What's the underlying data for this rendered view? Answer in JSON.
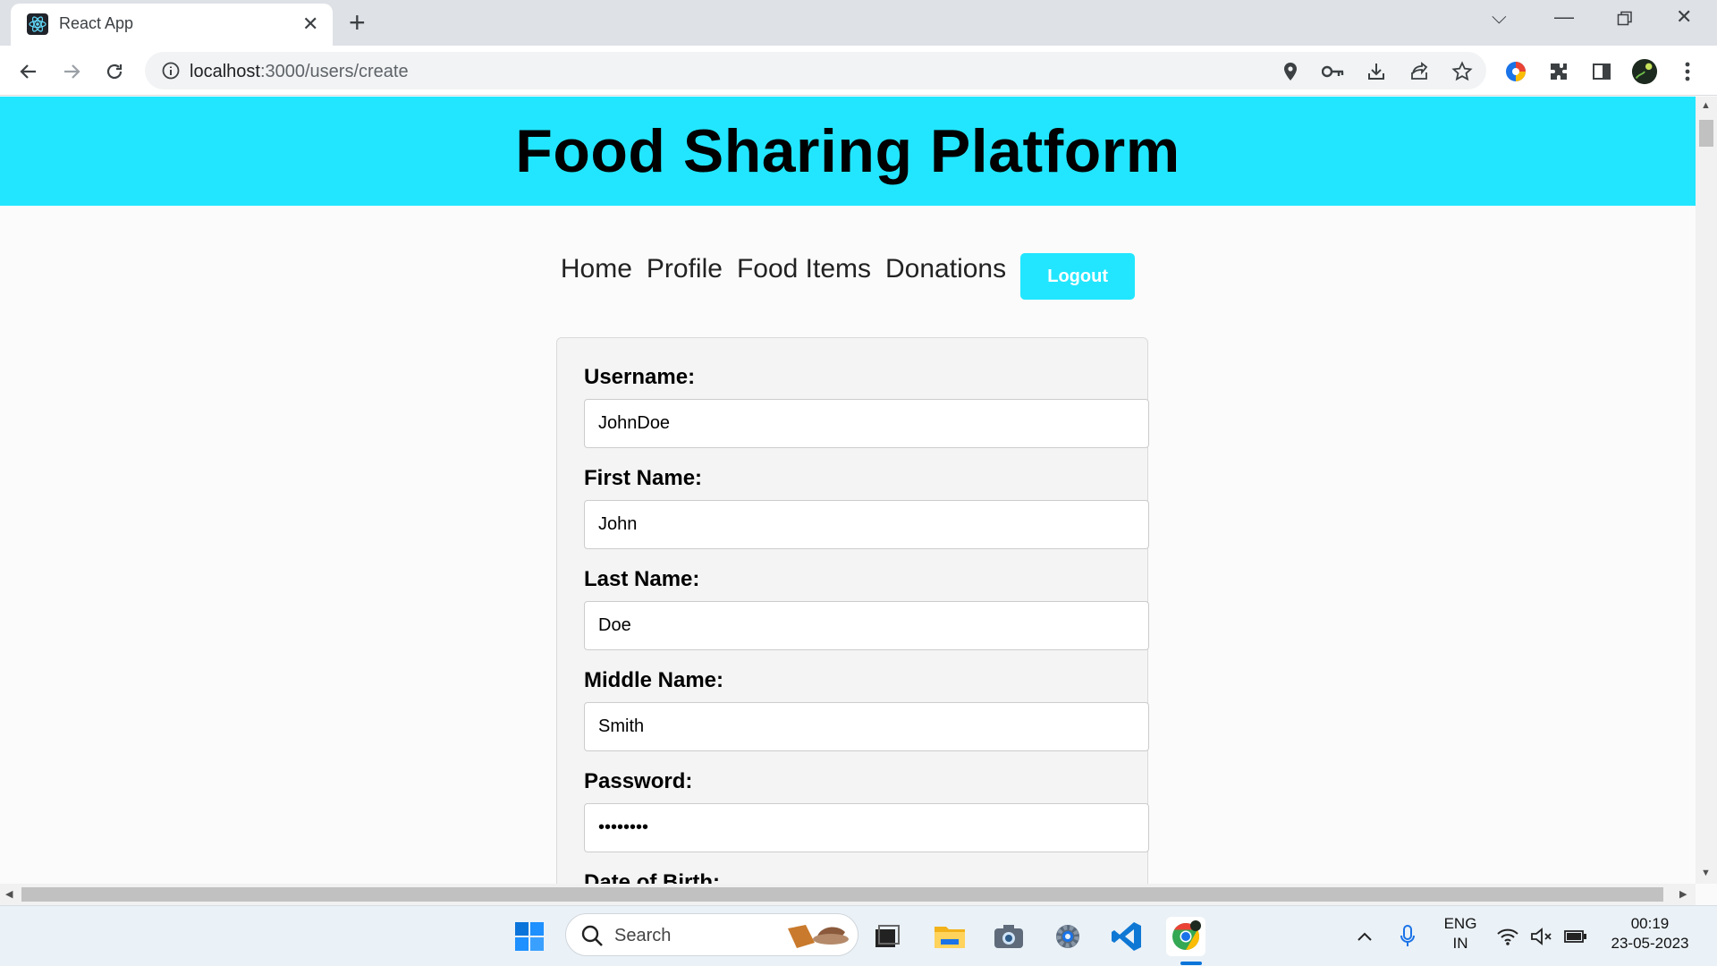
{
  "browser": {
    "tab_title": "React App",
    "url_host": "localhost",
    "url_path": ":3000/users/create"
  },
  "app": {
    "title": "Food Sharing Platform",
    "accent_color": "#22e6ff",
    "nav": [
      "Home",
      "Profile",
      "Food Items",
      "Donations"
    ],
    "logout_label": "Logout"
  },
  "form": {
    "fields": [
      {
        "label": "Username:",
        "value": "JohnDoe"
      },
      {
        "label": "First Name:",
        "value": "John"
      },
      {
        "label": "Last Name:",
        "value": "Doe"
      },
      {
        "label": "Middle Name:",
        "value": "Smith"
      },
      {
        "label": "Password:",
        "value": "••••••••"
      }
    ],
    "partial_label": "Date of Birth:"
  },
  "taskbar": {
    "search_label": "Search",
    "lang_primary": "ENG",
    "lang_secondary": "IN",
    "time": "00:19",
    "date": "23-05-2023"
  }
}
